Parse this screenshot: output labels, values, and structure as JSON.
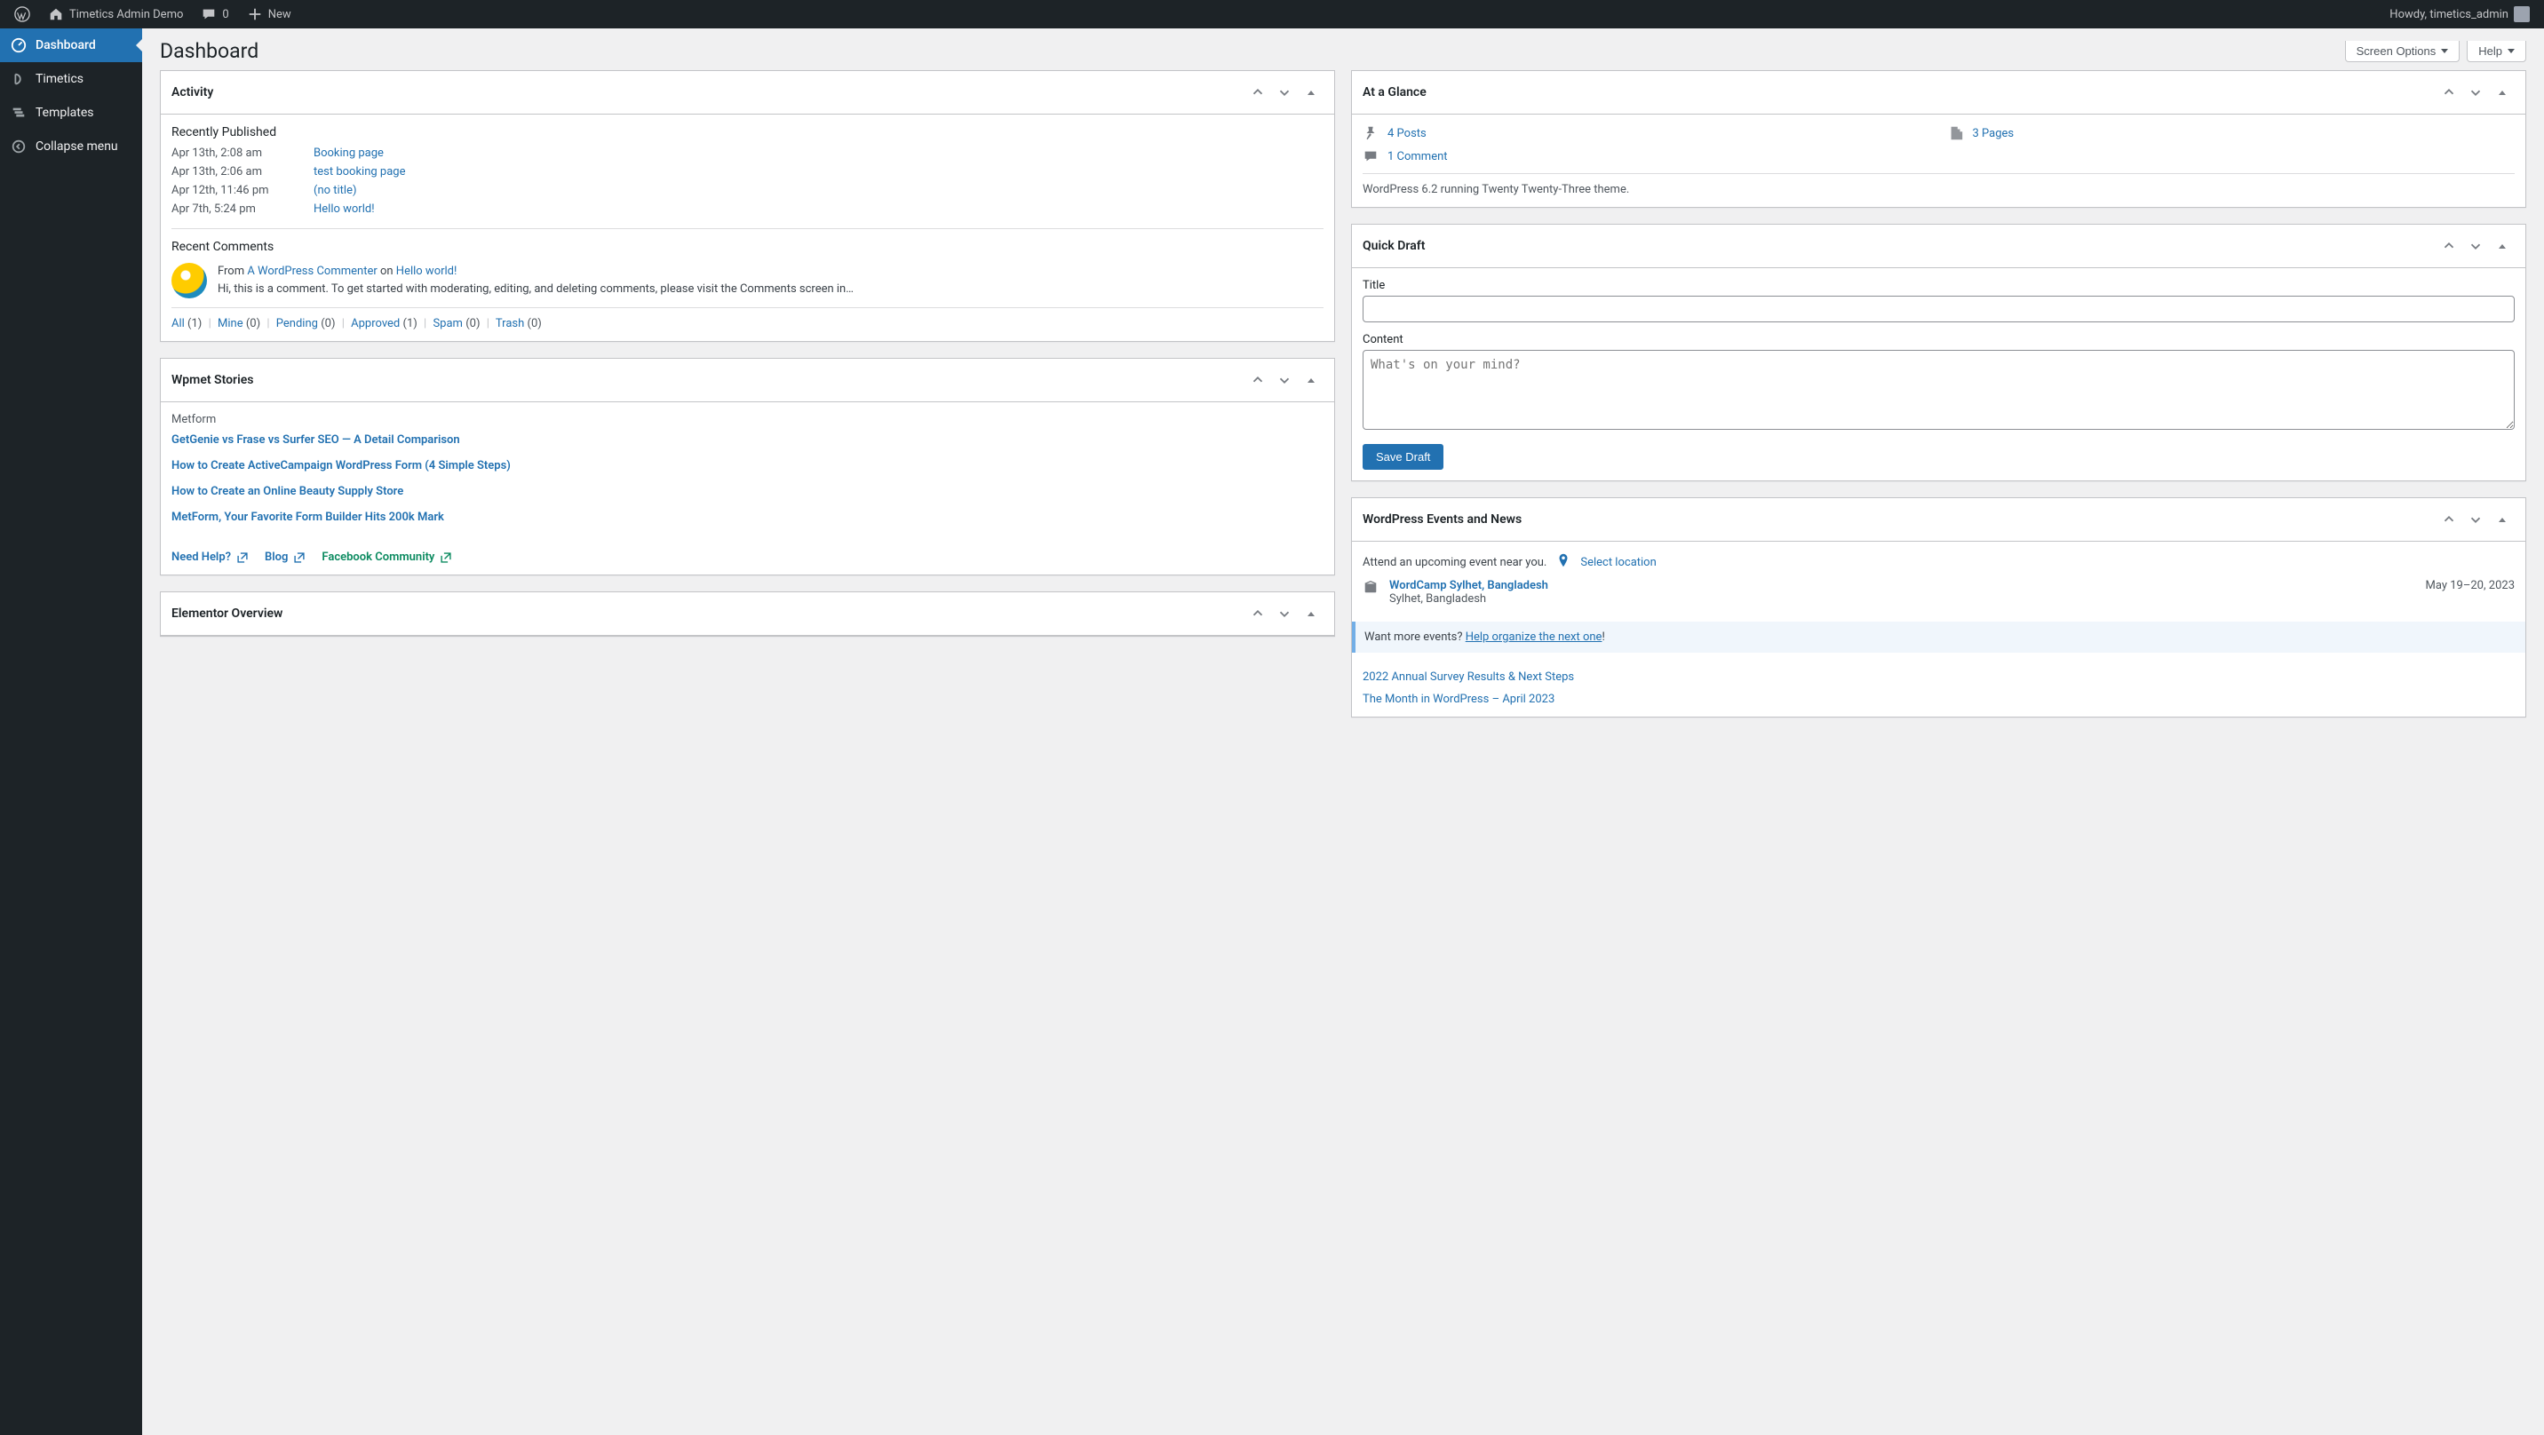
{
  "topbar": {
    "site_name": "Timetics Admin Demo",
    "comments_count": "0",
    "new_label": "New",
    "howdy": "Howdy, timetics_admin"
  },
  "sidebar": {
    "items": [
      {
        "label": "Dashboard",
        "icon": "dashboard-icon",
        "current": true
      },
      {
        "label": "Timetics",
        "icon": "timetics-icon",
        "current": false
      },
      {
        "label": "Templates",
        "icon": "templates-icon",
        "current": false
      },
      {
        "label": "Collapse menu",
        "icon": "collapse-icon",
        "current": false
      }
    ]
  },
  "page": {
    "title": "Dashboard",
    "screen_options": "Screen Options",
    "help": "Help"
  },
  "activity": {
    "title": "Activity",
    "recently_published": "Recently Published",
    "posts": [
      {
        "date": "Apr 13th, 2:08 am",
        "title": "Booking page"
      },
      {
        "date": "Apr 13th, 2:06 am",
        "title": "test booking page"
      },
      {
        "date": "Apr 12th, 11:46 pm",
        "title": "(no title)"
      },
      {
        "date": "Apr 7th, 5:24 pm",
        "title": "Hello world!"
      }
    ],
    "recent_comments": "Recent Comments",
    "comment": {
      "from_prefix": "From ",
      "author": "A WordPress Commenter",
      "on": " on ",
      "post": "Hello world!",
      "text": "Hi, this is a comment. To get started with moderating, editing, and deleting comments, please visit the Comments screen in…"
    },
    "filters": {
      "all": "All",
      "all_n": "(1)",
      "mine": "Mine",
      "mine_n": "(0)",
      "pending": "Pending",
      "pending_n": "(0)",
      "approved": "Approved",
      "approved_n": "(1)",
      "spam": "Spam",
      "spam_n": "(0)",
      "trash": "Trash",
      "trash_n": "(0)"
    }
  },
  "wpmet": {
    "title": "Wpmet Stories",
    "subhead": "Metform",
    "stories": [
      "GetGenie vs Frase vs Surfer SEO — A Detail Comparison",
      "How to Create ActiveCampaign WordPress Form (4 Simple Steps)",
      "How to Create an Online Beauty Supply Store",
      "MetForm, Your Favorite Form Builder Hits 200k Mark"
    ],
    "need_help": "Need Help?",
    "blog": "Blog",
    "facebook": "Facebook Community"
  },
  "elementor": {
    "title": "Elementor Overview"
  },
  "glance": {
    "title": "At a Glance",
    "posts": "4 Posts",
    "pages": "3 Pages",
    "comments": "1 Comment",
    "version": "WordPress 6.2 running Twenty Twenty-Three theme."
  },
  "quickdraft": {
    "title": "Quick Draft",
    "title_label": "Title",
    "content_label": "Content",
    "content_placeholder": "What's on your mind?",
    "save": "Save Draft"
  },
  "events": {
    "title": "WordPress Events and News",
    "attend": "Attend an upcoming event near you.",
    "select_location": "Select location",
    "event_name": "WordCamp Sylhet, Bangladesh",
    "event_place": "Sylhet, Bangladesh",
    "event_date": "May 19–20, 2023",
    "want_more": "Want more events? ",
    "help_organize": "Help organize the next one",
    "exclaim": "!",
    "news": [
      "2022 Annual Survey Results & Next Steps",
      "The Month in WordPress – April 2023"
    ]
  }
}
